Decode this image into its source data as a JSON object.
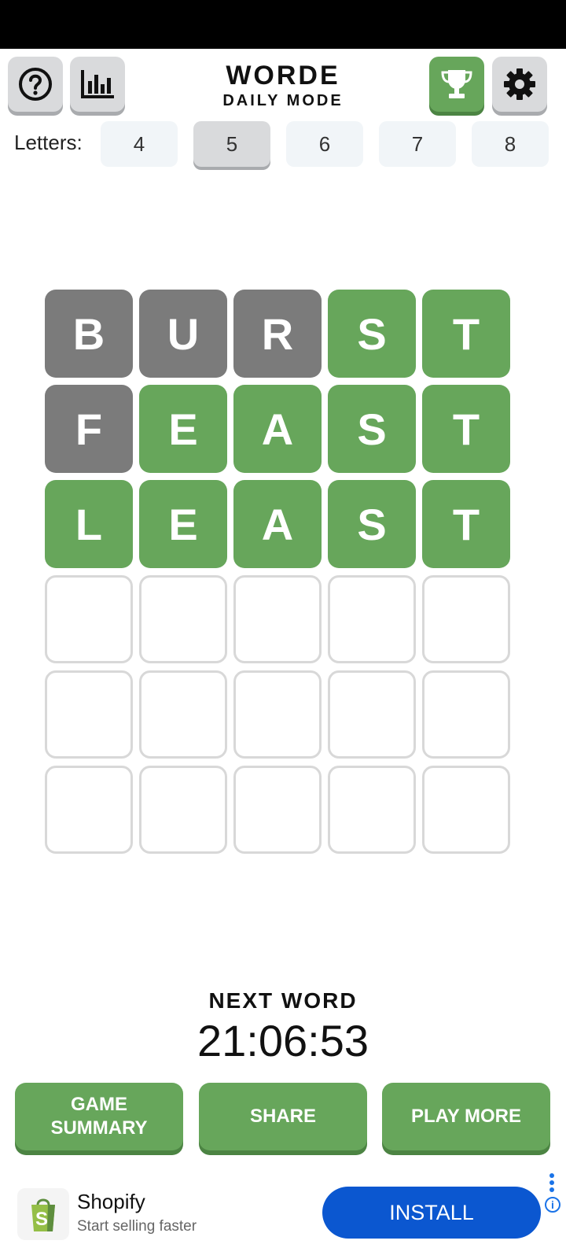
{
  "header": {
    "title": "WORDE",
    "subtitle": "DAILY MODE",
    "buttons": {
      "help": "help-icon",
      "stats": "bar-chart-icon",
      "trophy": "trophy-icon",
      "settings": "gear-icon"
    }
  },
  "letters": {
    "label": "Letters:",
    "options": [
      "4",
      "5",
      "6",
      "7",
      "8"
    ],
    "selected": "5"
  },
  "board": {
    "rows": [
      [
        {
          "letter": "B",
          "state": "absent"
        },
        {
          "letter": "U",
          "state": "absent"
        },
        {
          "letter": "R",
          "state": "absent"
        },
        {
          "letter": "S",
          "state": "correct"
        },
        {
          "letter": "T",
          "state": "correct"
        }
      ],
      [
        {
          "letter": "F",
          "state": "absent"
        },
        {
          "letter": "E",
          "state": "correct"
        },
        {
          "letter": "A",
          "state": "correct"
        },
        {
          "letter": "S",
          "state": "correct"
        },
        {
          "letter": "T",
          "state": "correct"
        }
      ],
      [
        {
          "letter": "L",
          "state": "correct"
        },
        {
          "letter": "E",
          "state": "correct"
        },
        {
          "letter": "A",
          "state": "correct"
        },
        {
          "letter": "S",
          "state": "correct"
        },
        {
          "letter": "T",
          "state": "correct"
        }
      ],
      [
        {
          "letter": "",
          "state": "empty"
        },
        {
          "letter": "",
          "state": "empty"
        },
        {
          "letter": "",
          "state": "empty"
        },
        {
          "letter": "",
          "state": "empty"
        },
        {
          "letter": "",
          "state": "empty"
        }
      ],
      [
        {
          "letter": "",
          "state": "empty"
        },
        {
          "letter": "",
          "state": "empty"
        },
        {
          "letter": "",
          "state": "empty"
        },
        {
          "letter": "",
          "state": "empty"
        },
        {
          "letter": "",
          "state": "empty"
        }
      ],
      [
        {
          "letter": "",
          "state": "empty"
        },
        {
          "letter": "",
          "state": "empty"
        },
        {
          "letter": "",
          "state": "empty"
        },
        {
          "letter": "",
          "state": "empty"
        },
        {
          "letter": "",
          "state": "empty"
        }
      ]
    ]
  },
  "next_word": {
    "label": "NEXT WORD",
    "timer": "21:06:53"
  },
  "actions": {
    "game_summary_line1": "GAME",
    "game_summary_line2": "SUMMARY",
    "share": "SHARE",
    "play_more": "PLAY MORE"
  },
  "ad": {
    "advertiser": "Shopify",
    "tagline": "Start selling faster",
    "cta": "INSTALL"
  },
  "colors": {
    "correct": "#67a65b",
    "absent": "#7b7b7b",
    "install": "#0b57d0"
  }
}
